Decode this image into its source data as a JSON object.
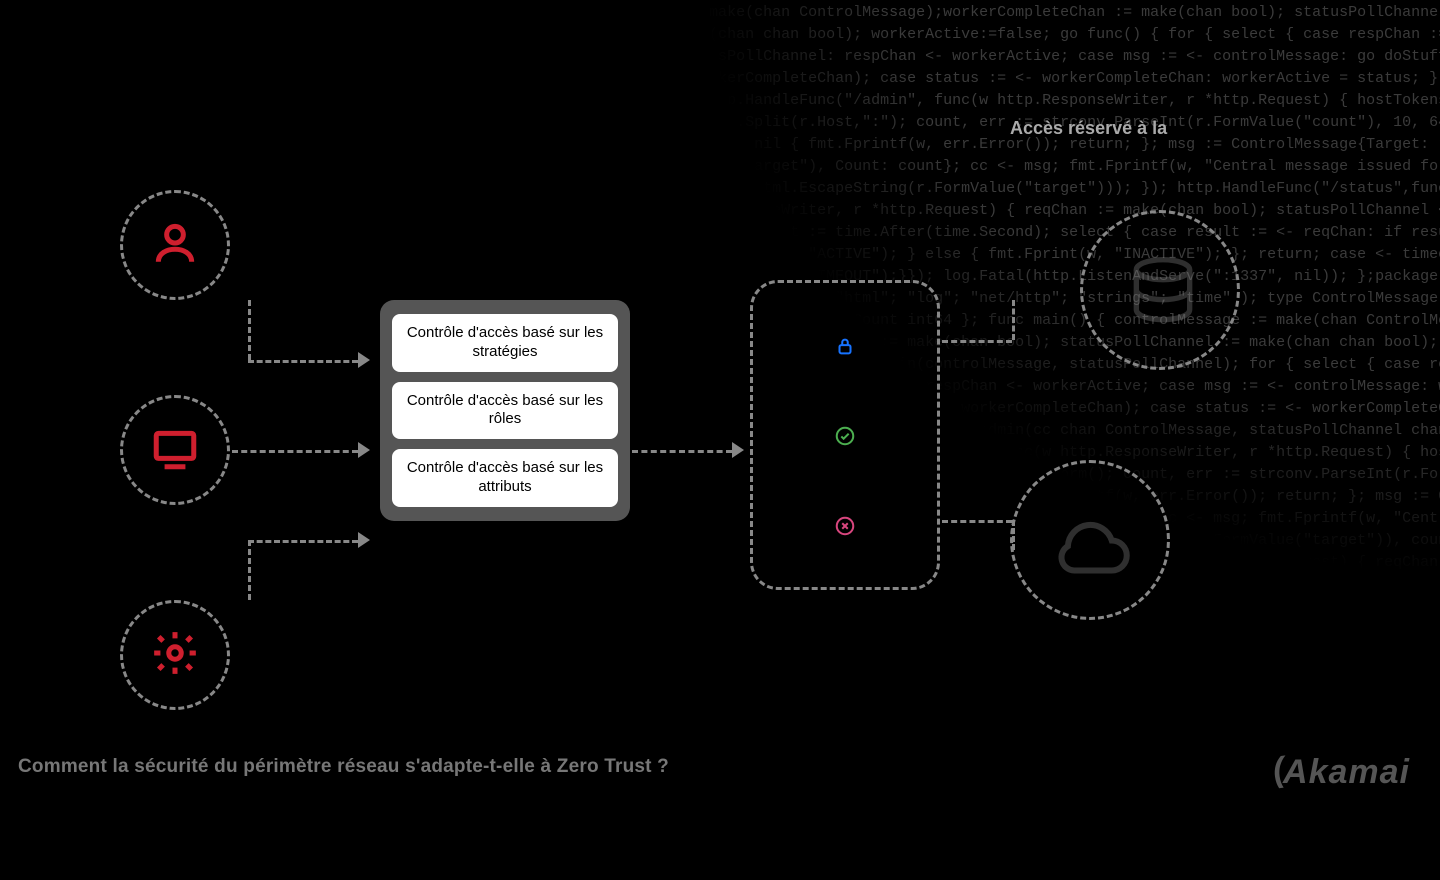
{
  "left_icons": [
    "user-icon",
    "monitor-icon",
    "gear-icon"
  ],
  "access_controls": [
    "Contrôle d'accès basé sur les stratégies",
    "Contrôle d'accès basé sur les rôles",
    "Contrôle d'accès basé sur les attributs"
  ],
  "phone_icons": [
    "lock-icon",
    "check-circle-icon",
    "x-circle-icon"
  ],
  "top_label": "Accès réservé à la",
  "caption": "Comment la sécurité du périmètre réseau s'adapte-t-elle à Zero Trust ?",
  "brand": "Akamai",
  "colors": {
    "accent": "#cf1f2e",
    "lock": "#1773ff",
    "check": "#4caf50",
    "x": "#d8467e",
    "grey": "#888"
  },
  "code_blob": "al\"; \"log\"; \"net/http\"; \"strconv\"; \"strings\"; \"time\" ); type ControlMessage struct { Target string; Count int64 }; controlMessage:=make(chan ControlMessage);workerCompleteChan := make(chan bool); statusPollChannel := make(chan chan bool); workerActive:=false; go func() { for { select { case respChan := <- statusPollChannel: respChan <- workerActive; case msg := <- controlMessage: go doStuff(msg, workerCompleteChan); case status := <- workerCompleteChan: workerActive = status; } } }(); http.HandleFunc(\"/admin\", func(w http.ResponseWriter, r *http.Request) { hostTokens := strings.Split(r.Host,\":\"); count, err := strconv.ParseInt(r.FormValue(\"count\"), 10, 64); if err != nil { fmt.Fprintf(w, err.Error()); return; }; msg := ControlMessage{Target: r.FormValue(\"target\"), Count: count}; cc <- msg; fmt.Fprintf(w, \"Central message issued for Target %s\", html.EscapeString(r.FormValue(\"target\"))); }); http.HandleFunc(\"/status\",func(w http.ResponseWriter, r *http.Request) { reqChan := make(chan bool); statusPollChannel <- reqChan; timeout := time.After(time.Second); select { case result := <- reqChan: if result { fmt.Fprint(w, \"ACTIVE\"); } else { fmt.Fprint(w, \"INACTIVE\"); }; return; case <- timeout: fmt.Fprint(w, \"TIMEOUT\");}}); log.Fatal(http.ListenAndServe(\":1337\", nil)); };package main; import ( \"fmt\"; \"html\"; \"log\"; \"net/http\"; \"strings\"; \"time\" ); type ControlMessage struct { Target string; Count int64 }; func main() { controlMessage := make(chan ControlMessage); workerCompleteChan := make(chan bool); statusPollChannel := make(chan chan bool); workerActive := false; go admin(controlMessage, statusPollChannel); for { select { case respChan := <- statusPollChannel: respChan <- workerActive; case msg := <- controlMessage: workerActive = true; go doStuff(msg, workerCompleteChan); case status := <- workerCompleteChan: workerActive = status; }}}; func admin(cc chan ControlMessage, statusPollChannel chan chan bool) { http.HandleFunc(\"/admin\", func(w http.ResponseWriter, r *http.Request) { hostTokens := strings.Split(r.Host, \":\"); r.ParseForm(); count, err := strconv.ParseInt(r.FormValue(\"count\"), 10, 64); if err != nil { fmt.Fprintf(w, err.Error()); return; }; msg := ControlMessage{Target:r.FormValue(\"target\"), Count:count}; cc <- msg; fmt.Fprintf(w, \"Central message issued for Target %s, count %d\", html.EscapeString(r.FormValue(\"target\")), count); }); http.HandleFunc(\"/status\", func(w http.ResponseWriter, r *http.Request) { reqChan := make(chan bool); statusPollChannel <- reqChan; timeout := time.After(time.Second); select { case result := <-reqChan: if result { fmt.Fprint(w, \"ACTIVE\"); } else { fmt.Fprint(w, \"INACTIVE\"); }; case <- timeout: fmt.Fprint(w, \"TIMEOUT\"); }}); log.Fatal(http.ListenAndServe(\":1337\", nil)); }"
}
